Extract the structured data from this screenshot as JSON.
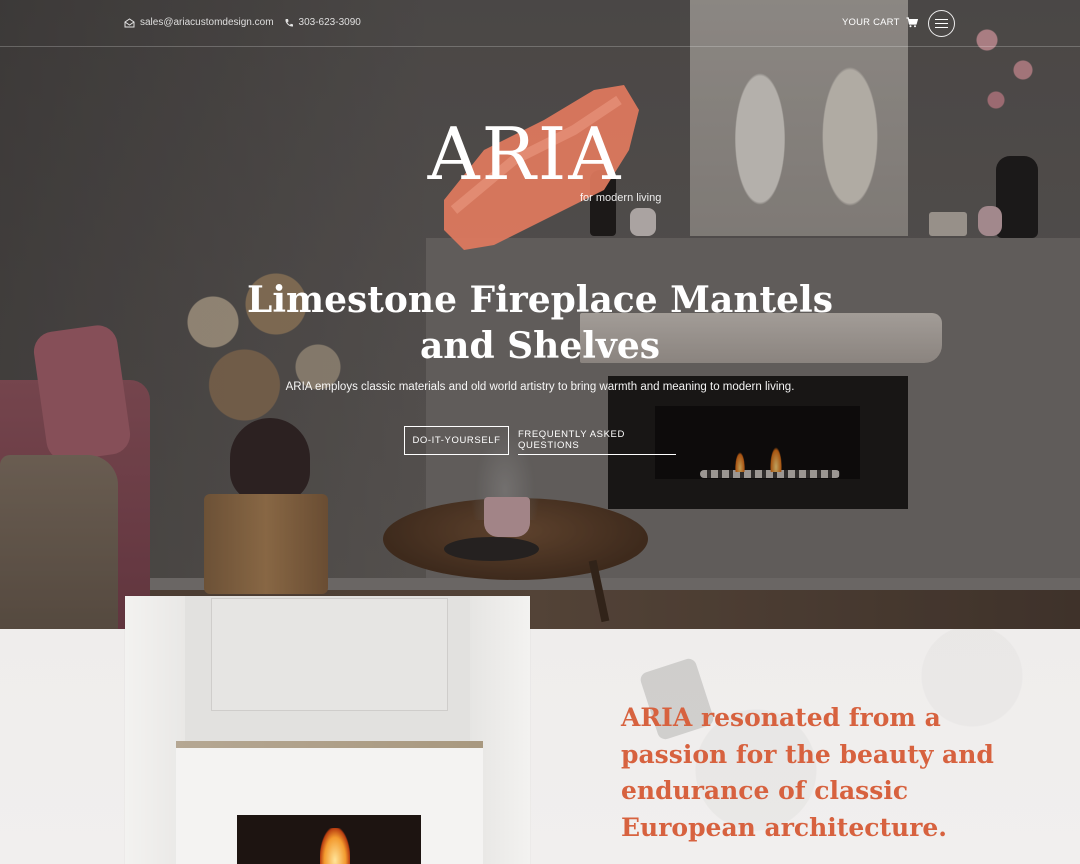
{
  "header": {
    "email": "sales@ariacustomdesign.com",
    "phone": "303-623-3090",
    "cart_label": "YOUR CART",
    "icons": {
      "email": "mail-icon",
      "phone": "phone-icon",
      "cart": "cart-icon",
      "menu": "hamburger-menu-icon"
    }
  },
  "logo": {
    "wordmark": "ARIA",
    "tagline": "for modern living",
    "brush_color": "#e17a5e"
  },
  "hero": {
    "title_line1": "Limestone Fireplace Mantels",
    "title_line2": "and Shelves",
    "subtitle": "ARIA employs classic materials and old world artistry to bring warmth and meaning to modern living.",
    "buttons": {
      "diy": "DO-IT-YOURSELF",
      "faq": "FREQUENTLY ASKED QUESTIONS"
    }
  },
  "about": {
    "heading_line1": "ARIA resonated from a",
    "heading_line2": "passion for the beauty and",
    "heading_line3": "endurance of classic",
    "heading_line4": "European architecture.",
    "accent_color": "#d7623f"
  }
}
